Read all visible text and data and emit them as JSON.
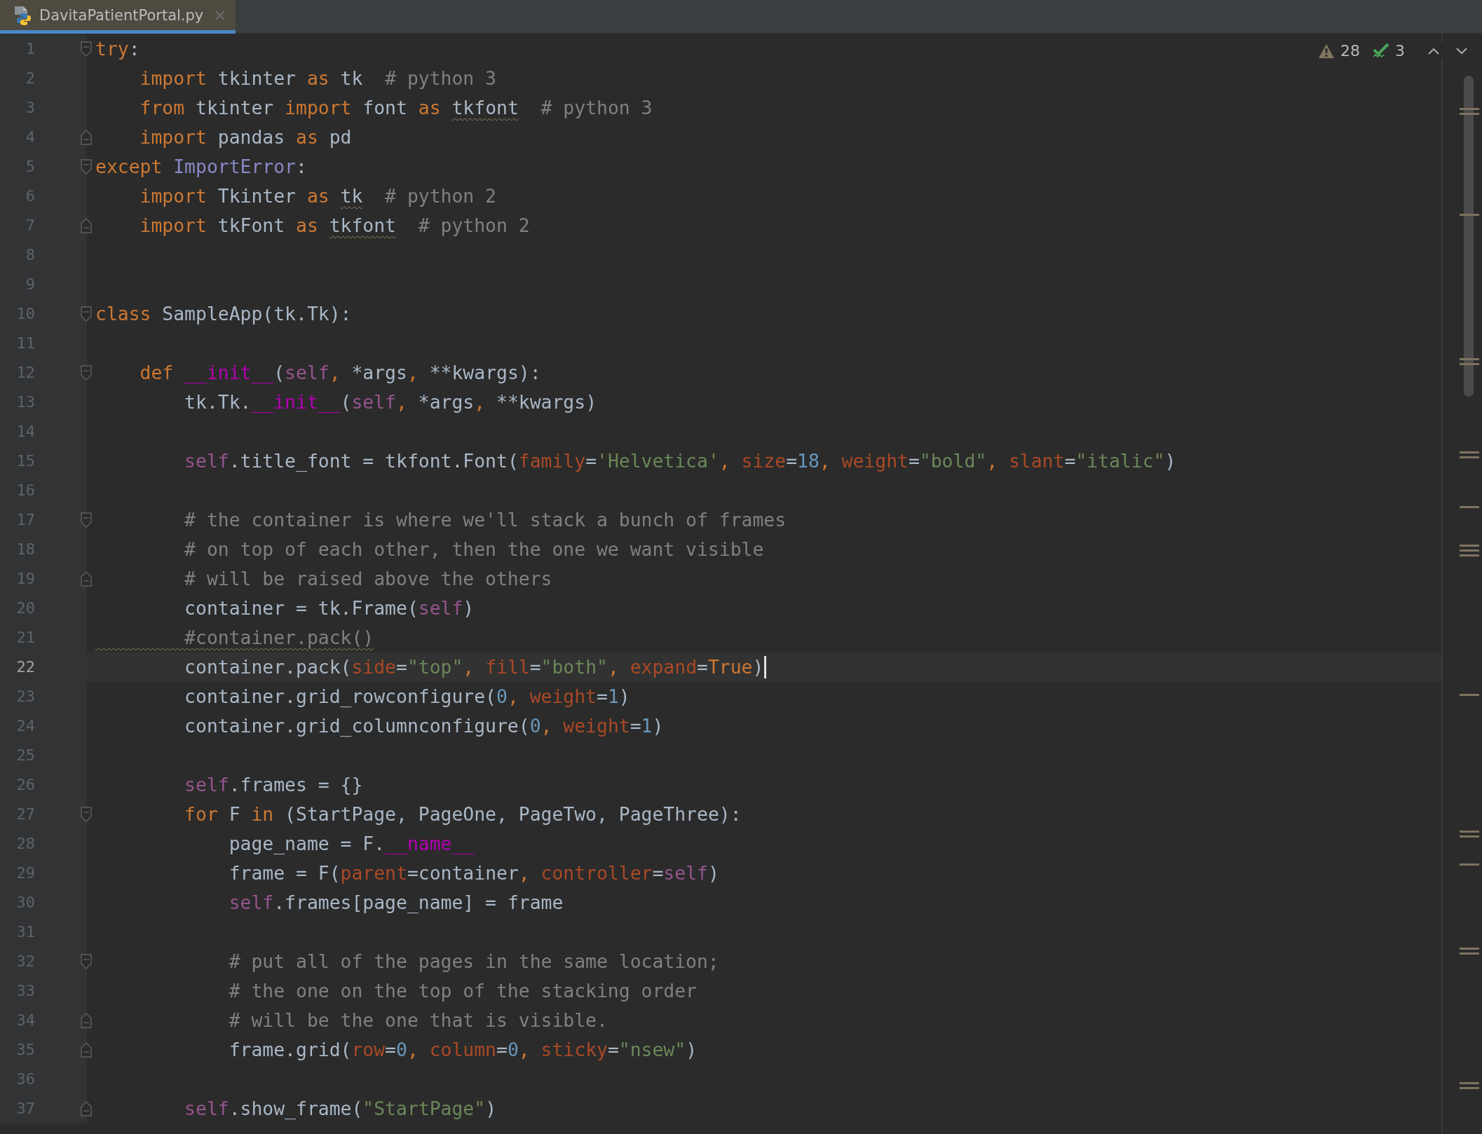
{
  "tabs": [
    {
      "label": "DavitaPatientPortal.py",
      "selected": true
    }
  ],
  "inspections": {
    "warnings": "28",
    "weak_warnings": "3"
  },
  "lines": [
    {
      "number": "1",
      "fold_start": true,
      "tokens": [
        {
          "kind": "kw",
          "text": "try"
        },
        {
          "kind": "plain",
          "text": ":"
        }
      ]
    },
    {
      "number": "2",
      "tokens": [
        {
          "kind": "kw",
          "text": "    import"
        },
        {
          "kind": "plain",
          "text": " tkinter "
        },
        {
          "kind": "kw",
          "text": "as"
        },
        {
          "kind": "plain",
          "text": " tk  "
        },
        {
          "kind": "comment",
          "text": "# python 3"
        }
      ]
    },
    {
      "number": "3",
      "tokens": [
        {
          "kind": "kw",
          "text": "    from"
        },
        {
          "kind": "plain",
          "text": " tkinter "
        },
        {
          "kind": "kw",
          "text": "import"
        },
        {
          "kind": "plain",
          "text": " font "
        },
        {
          "kind": "kw",
          "text": "as "
        },
        {
          "kind": "plain",
          "text": "tkfont",
          "warn": true
        },
        {
          "kind": "comment",
          "text": "  # python 3"
        }
      ]
    },
    {
      "number": "4",
      "fold_end": true,
      "tokens": [
        {
          "kind": "kw",
          "text": "    import"
        },
        {
          "kind": "plain",
          "text": " pandas "
        },
        {
          "kind": "kw",
          "text": "as"
        },
        {
          "kind": "plain",
          "text": " pd"
        }
      ]
    },
    {
      "number": "5",
      "fold_start": true,
      "tokens": [
        {
          "kind": "kw",
          "text": "except "
        },
        {
          "kind": "builtin",
          "text": "ImportError"
        },
        {
          "kind": "plain",
          "text": ":"
        }
      ]
    },
    {
      "number": "6",
      "tokens": [
        {
          "kind": "kw",
          "text": "    import"
        },
        {
          "kind": "plain",
          "text": " Tkinter "
        },
        {
          "kind": "kw",
          "text": "as "
        },
        {
          "kind": "plain",
          "text": "tk",
          "warn": true
        },
        {
          "kind": "comment",
          "text": "  # python 2"
        }
      ]
    },
    {
      "number": "7",
      "fold_end": true,
      "tokens": [
        {
          "kind": "kw",
          "text": "    import"
        },
        {
          "kind": "plain",
          "text": " tkFont "
        },
        {
          "kind": "kw",
          "text": "as "
        },
        {
          "kind": "plain",
          "text": "tkfont",
          "warn": true
        },
        {
          "kind": "comment",
          "text": "  # python 2"
        }
      ]
    },
    {
      "number": "8"
    },
    {
      "number": "9"
    },
    {
      "number": "10",
      "fold_start": true,
      "tokens": [
        {
          "kind": "kw",
          "text": "class"
        },
        {
          "kind": "plain",
          "text": " SampleApp(tk.Tk):"
        }
      ]
    },
    {
      "number": "11"
    },
    {
      "number": "12",
      "fold_start": true,
      "tokens": [
        {
          "kind": "kw",
          "text": "    def "
        },
        {
          "kind": "magic",
          "text": "__init__"
        },
        {
          "kind": "plain",
          "text": "("
        },
        {
          "kind": "self",
          "text": "self"
        },
        {
          "kind": "kw",
          "text": ","
        },
        {
          "kind": "plain",
          "text": " *args"
        },
        {
          "kind": "kw",
          "text": ","
        },
        {
          "kind": "plain",
          "text": " **kwargs):"
        }
      ]
    },
    {
      "number": "13",
      "tokens": [
        {
          "kind": "plain",
          "text": "        tk.Tk."
        },
        {
          "kind": "magic",
          "text": "__init__"
        },
        {
          "kind": "plain",
          "text": "("
        },
        {
          "kind": "self",
          "text": "self"
        },
        {
          "kind": "kw",
          "text": ","
        },
        {
          "kind": "plain",
          "text": " *args"
        },
        {
          "kind": "kw",
          "text": ","
        },
        {
          "kind": "plain",
          "text": " **kwargs)"
        }
      ]
    },
    {
      "number": "14"
    },
    {
      "number": "15",
      "tokens": [
        {
          "kind": "self",
          "text": "        self"
        },
        {
          "kind": "plain",
          "text": ".title_font = tkfont.Font("
        },
        {
          "kind": "param",
          "text": "family"
        },
        {
          "kind": "plain",
          "text": "="
        },
        {
          "kind": "str",
          "text": "'Helvetica'"
        },
        {
          "kind": "kw",
          "text": ", "
        },
        {
          "kind": "param",
          "text": "size"
        },
        {
          "kind": "plain",
          "text": "="
        },
        {
          "kind": "num",
          "text": "18"
        },
        {
          "kind": "kw",
          "text": ", "
        },
        {
          "kind": "param",
          "text": "weight"
        },
        {
          "kind": "plain",
          "text": "="
        },
        {
          "kind": "str",
          "text": "\"bold\""
        },
        {
          "kind": "kw",
          "text": ", "
        },
        {
          "kind": "param",
          "text": "slant"
        },
        {
          "kind": "plain",
          "text": "="
        },
        {
          "kind": "str",
          "text": "\"italic\""
        },
        {
          "kind": "plain",
          "text": ")"
        }
      ]
    },
    {
      "number": "16"
    },
    {
      "number": "17",
      "fold_start": true,
      "tokens": [
        {
          "kind": "comment",
          "text": "        # the container is where we'll stack a bunch of frames"
        }
      ]
    },
    {
      "number": "18",
      "tokens": [
        {
          "kind": "comment",
          "text": "        # on top of each other, then the one we want visible"
        }
      ]
    },
    {
      "number": "19",
      "fold_end": true,
      "tokens": [
        {
          "kind": "comment",
          "text": "        # will be raised above the others"
        }
      ]
    },
    {
      "number": "20",
      "tokens": [
        {
          "kind": "plain",
          "text": "        container = tk.Frame("
        },
        {
          "kind": "self",
          "text": "self"
        },
        {
          "kind": "plain",
          "text": ")"
        }
      ]
    },
    {
      "number": "21",
      "tokens": [
        {
          "kind": "comment",
          "text": "        #container.pack()",
          "warn": true
        }
      ]
    },
    {
      "number": "22",
      "current": true,
      "tokens": [
        {
          "kind": "plain",
          "text": "        container.pack("
        },
        {
          "kind": "param",
          "text": "side"
        },
        {
          "kind": "plain",
          "text": "="
        },
        {
          "kind": "str",
          "text": "\"top\""
        },
        {
          "kind": "kw",
          "text": ", "
        },
        {
          "kind": "param",
          "text": "fill"
        },
        {
          "kind": "plain",
          "text": "="
        },
        {
          "kind": "str",
          "text": "\"both\""
        },
        {
          "kind": "kw",
          "text": ", "
        },
        {
          "kind": "param",
          "text": "expand"
        },
        {
          "kind": "plain",
          "text": "="
        },
        {
          "kind": "kw",
          "text": "True"
        },
        {
          "kind": "plain",
          "text": ")"
        }
      ]
    },
    {
      "number": "23",
      "tokens": [
        {
          "kind": "plain",
          "text": "        container.grid_rowconfigure("
        },
        {
          "kind": "num",
          "text": "0"
        },
        {
          "kind": "kw",
          "text": ", "
        },
        {
          "kind": "param",
          "text": "weight"
        },
        {
          "kind": "plain",
          "text": "="
        },
        {
          "kind": "num",
          "text": "1"
        },
        {
          "kind": "plain",
          "text": ")"
        }
      ]
    },
    {
      "number": "24",
      "tokens": [
        {
          "kind": "plain",
          "text": "        container.grid_columnconfigure("
        },
        {
          "kind": "num",
          "text": "0"
        },
        {
          "kind": "kw",
          "text": ", "
        },
        {
          "kind": "param",
          "text": "weight"
        },
        {
          "kind": "plain",
          "text": "="
        },
        {
          "kind": "num",
          "text": "1"
        },
        {
          "kind": "plain",
          "text": ")"
        }
      ]
    },
    {
      "number": "25"
    },
    {
      "number": "26",
      "tokens": [
        {
          "kind": "self",
          "text": "        self"
        },
        {
          "kind": "plain",
          "text": ".frames = {}"
        }
      ]
    },
    {
      "number": "27",
      "fold_start": true,
      "tokens": [
        {
          "kind": "kw",
          "text": "        for"
        },
        {
          "kind": "plain",
          "text": " F "
        },
        {
          "kind": "kw",
          "text": "in"
        },
        {
          "kind": "plain",
          "text": " (StartPage, PageOne, PageTwo, PageThree):"
        }
      ]
    },
    {
      "number": "28",
      "tokens": [
        {
          "kind": "plain",
          "text": "            page_name = F."
        },
        {
          "kind": "magic",
          "text": "__name__"
        }
      ]
    },
    {
      "number": "29",
      "tokens": [
        {
          "kind": "plain",
          "text": "            frame = F("
        },
        {
          "kind": "param",
          "text": "parent"
        },
        {
          "kind": "plain",
          "text": "=container"
        },
        {
          "kind": "kw",
          "text": ", "
        },
        {
          "kind": "param",
          "text": "controller"
        },
        {
          "kind": "plain",
          "text": "="
        },
        {
          "kind": "self",
          "text": "self"
        },
        {
          "kind": "plain",
          "text": ")"
        }
      ]
    },
    {
      "number": "30",
      "tokens": [
        {
          "kind": "self",
          "text": "            self"
        },
        {
          "kind": "plain",
          "text": ".frames[page_name] = frame"
        }
      ]
    },
    {
      "number": "31"
    },
    {
      "number": "32",
      "fold_start": true,
      "tokens": [
        {
          "kind": "comment",
          "text": "            # put all of the pages in the same location;"
        }
      ]
    },
    {
      "number": "33",
      "tokens": [
        {
          "kind": "comment",
          "text": "            # the one on the top of the stacking order"
        }
      ]
    },
    {
      "number": "34",
      "fold_end": true,
      "tokens": [
        {
          "kind": "comment",
          "text": "            # will be the one that is visible."
        }
      ]
    },
    {
      "number": "35",
      "fold_end": true,
      "tokens": [
        {
          "kind": "plain",
          "text": "            frame.grid("
        },
        {
          "kind": "param",
          "text": "row"
        },
        {
          "kind": "plain",
          "text": "="
        },
        {
          "kind": "num",
          "text": "0"
        },
        {
          "kind": "kw",
          "text": ", "
        },
        {
          "kind": "param",
          "text": "column"
        },
        {
          "kind": "plain",
          "text": "="
        },
        {
          "kind": "num",
          "text": "0"
        },
        {
          "kind": "kw",
          "text": ", "
        },
        {
          "kind": "param",
          "text": "sticky"
        },
        {
          "kind": "plain",
          "text": "="
        },
        {
          "kind": "str",
          "text": "\"nsew\""
        },
        {
          "kind": "plain",
          "text": ")"
        }
      ]
    },
    {
      "number": "36"
    },
    {
      "number": "37",
      "fold_end": true,
      "tokens": [
        {
          "kind": "self",
          "text": "        self"
        },
        {
          "kind": "plain",
          "text": ".show_frame("
        },
        {
          "kind": "str",
          "text": "\"StartPage\""
        },
        {
          "kind": "plain",
          "text": ")"
        }
      ]
    }
  ]
}
